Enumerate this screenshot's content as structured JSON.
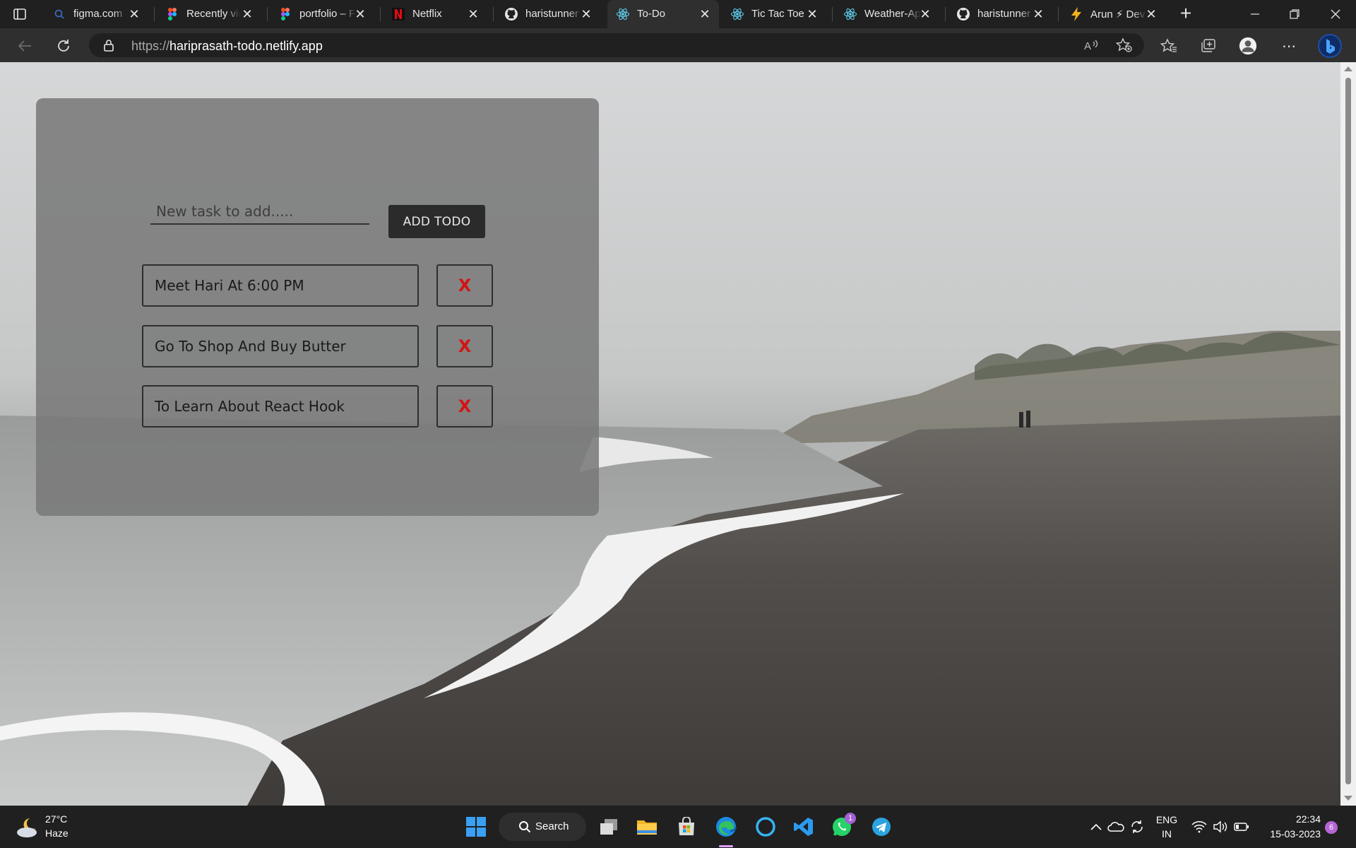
{
  "browser": {
    "tabs": [
      {
        "title": "figma.com",
        "icon": "search-icon",
        "active": false
      },
      {
        "title": "Recently viewed",
        "icon": "figma-icon",
        "active": false
      },
      {
        "title": "portfolio – Figma",
        "icon": "figma-icon",
        "active": false
      },
      {
        "title": "Netflix",
        "icon": "netflix-icon",
        "active": false
      },
      {
        "title": "haristunner",
        "icon": "github-icon",
        "active": false
      },
      {
        "title": "To-Do",
        "icon": "react-icon",
        "active": true
      },
      {
        "title": "Tic Tac Toe",
        "icon": "react-icon",
        "active": false
      },
      {
        "title": "Weather-App",
        "icon": "react-icon",
        "active": false
      },
      {
        "title": "haristunner",
        "icon": "github-icon",
        "active": false
      },
      {
        "title": "Arun ⚡ Dev",
        "icon": "lightning-icon",
        "active": false
      }
    ],
    "address": {
      "scheme": "https://",
      "host": "hariprasath-todo.netlify.app"
    }
  },
  "todo_app": {
    "input_placeholder": "New task to add.....",
    "input_value": "",
    "add_button_label": "ADD TODO",
    "delete_label": "X",
    "items": [
      {
        "text": "Meet Hari At 6:00 PM"
      },
      {
        "text": "Go To Shop And Buy Butter"
      },
      {
        "text": "To Learn About React Hook"
      }
    ],
    "colors": {
      "delete": "#d41414",
      "card": "#7a7a7a"
    }
  },
  "taskbar": {
    "weather": {
      "temp": "27°C",
      "condition": "Haze"
    },
    "search_label": "Search",
    "language": {
      "line1": "ENG",
      "line2": "IN"
    },
    "clock": {
      "time": "22:34",
      "date": "15-03-2023"
    },
    "whatsapp_badge": "1",
    "notification_count": "6"
  }
}
